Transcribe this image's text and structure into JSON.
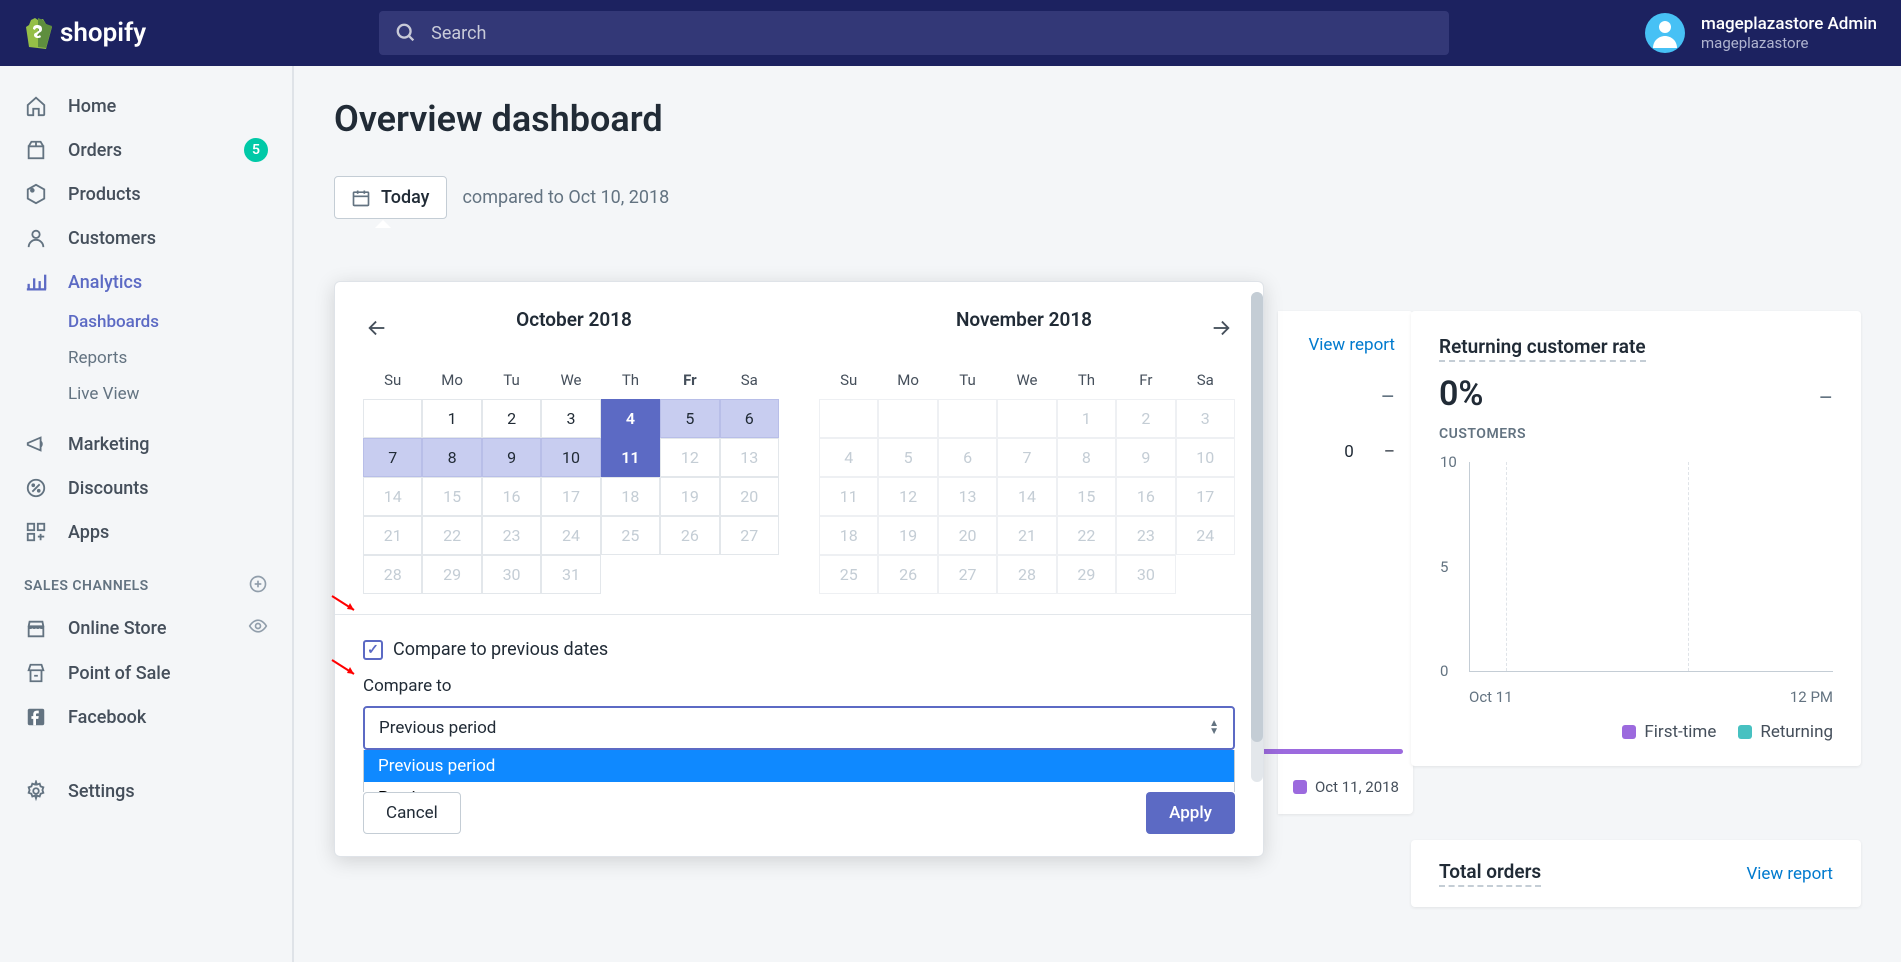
{
  "header": {
    "logo_text": "shopify",
    "search_placeholder": "Search",
    "user_name": "mageplazastore Admin",
    "user_store": "mageplazastore"
  },
  "sidebar": {
    "items": [
      {
        "label": "Home"
      },
      {
        "label": "Orders",
        "badge": "5"
      },
      {
        "label": "Products"
      },
      {
        "label": "Customers"
      },
      {
        "label": "Analytics"
      }
    ],
    "analytics_sub": [
      {
        "label": "Dashboards"
      },
      {
        "label": "Reports"
      },
      {
        "label": "Live View"
      }
    ],
    "items2": [
      {
        "label": "Marketing"
      },
      {
        "label": "Discounts"
      },
      {
        "label": "Apps"
      }
    ],
    "channels_header": "SALES CHANNELS",
    "channels": [
      {
        "label": "Online Store"
      },
      {
        "label": "Point of Sale"
      },
      {
        "label": "Facebook"
      }
    ],
    "settings": "Settings"
  },
  "page": {
    "title": "Overview dashboard",
    "today_btn": "Today",
    "compared_to": "compared to Oct 10, 2018"
  },
  "datepicker": {
    "month1": "October 2018",
    "month2": "November 2018",
    "dows": [
      "Su",
      "Mo",
      "Tu",
      "We",
      "Th",
      "Fr",
      "Sa"
    ],
    "compare_checkbox": "Compare to previous dates",
    "compare_to_label": "Compare to",
    "select_value": "Previous period",
    "options": [
      "Previous period",
      "Previous year"
    ],
    "cancel": "Cancel",
    "apply": "Apply"
  },
  "mid_card": {
    "view_report": "View report",
    "val1": "–",
    "val2_a": "0",
    "val2_b": "–",
    "date": "Oct 11, 2018"
  },
  "right_card": {
    "title": "Returning customer rate",
    "metric": "0%",
    "dash": "–",
    "sublabel": "CUSTOMERS",
    "y_ticks": [
      "10",
      "5",
      "0"
    ],
    "x_labels": [
      "Oct 11",
      "12 PM"
    ],
    "legend": [
      "First-time",
      "Returning"
    ],
    "colors": {
      "first": "#9c6ade",
      "returning": "#47c1c1"
    }
  },
  "bottom_card": {
    "title": "Total orders",
    "view_report": "View report"
  },
  "chart_data": {
    "type": "line",
    "title": "Returning customer rate — CUSTOMERS",
    "x": [
      "Oct 11",
      "12 PM"
    ],
    "series": [
      {
        "name": "First-time",
        "values": [
          0,
          0
        ],
        "color": "#9c6ade"
      },
      {
        "name": "Returning",
        "values": [
          0,
          0
        ],
        "color": "#47c1c1"
      }
    ],
    "ylim": [
      0,
      10
    ],
    "y_ticks": [
      0,
      5,
      10
    ],
    "ylabel": "Customers"
  }
}
